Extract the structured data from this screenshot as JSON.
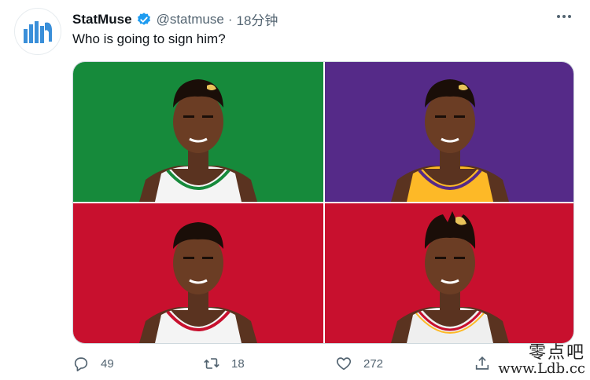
{
  "tweet": {
    "display_name": "StatMuse",
    "handle": "@statmuse",
    "separator": "·",
    "time": "18分钟",
    "text": "Who is going to sign him?",
    "avatar_icon": "statmuse-logo-icon",
    "verified_icon": "verified-badge-icon",
    "more_icon": "more-options-icon"
  },
  "media": {
    "tiles": [
      {
        "background": "#168a3b",
        "jersey": "celtics-white-green"
      },
      {
        "background": "#552a88",
        "jersey": "lakers-gold-purple"
      },
      {
        "background": "#c8102e",
        "jersey": "white-red"
      },
      {
        "background": "#c8102e",
        "jersey": "hawks-white-red-gold"
      }
    ]
  },
  "actions": {
    "reply_count": "49",
    "retweet_count": "18",
    "like_count": "272",
    "reply_icon": "reply-icon",
    "retweet_icon": "retweet-icon",
    "like_icon": "heart-icon",
    "share_icon": "share-icon"
  },
  "watermark": {
    "chinese": "零点吧",
    "url": "www.Ldb.cc"
  },
  "colors": {
    "verified": "#1d9bf0",
    "secondary_text": "#536471",
    "logo": "#3a8fd9"
  }
}
